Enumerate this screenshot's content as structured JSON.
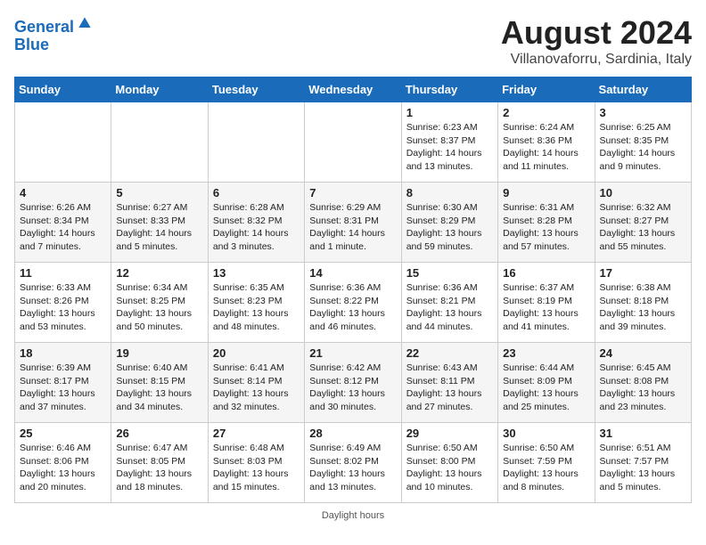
{
  "header": {
    "logo_line1": "General",
    "logo_line2": "Blue",
    "title": "August 2024",
    "subtitle": "Villanovaforru, Sardinia, Italy"
  },
  "days_of_week": [
    "Sunday",
    "Monday",
    "Tuesday",
    "Wednesday",
    "Thursday",
    "Friday",
    "Saturday"
  ],
  "weeks": [
    [
      {
        "day": "",
        "info": ""
      },
      {
        "day": "",
        "info": ""
      },
      {
        "day": "",
        "info": ""
      },
      {
        "day": "",
        "info": ""
      },
      {
        "day": "1",
        "info": "Sunrise: 6:23 AM\nSunset: 8:37 PM\nDaylight: 14 hours and 13 minutes."
      },
      {
        "day": "2",
        "info": "Sunrise: 6:24 AM\nSunset: 8:36 PM\nDaylight: 14 hours and 11 minutes."
      },
      {
        "day": "3",
        "info": "Sunrise: 6:25 AM\nSunset: 8:35 PM\nDaylight: 14 hours and 9 minutes."
      }
    ],
    [
      {
        "day": "4",
        "info": "Sunrise: 6:26 AM\nSunset: 8:34 PM\nDaylight: 14 hours and 7 minutes."
      },
      {
        "day": "5",
        "info": "Sunrise: 6:27 AM\nSunset: 8:33 PM\nDaylight: 14 hours and 5 minutes."
      },
      {
        "day": "6",
        "info": "Sunrise: 6:28 AM\nSunset: 8:32 PM\nDaylight: 14 hours and 3 minutes."
      },
      {
        "day": "7",
        "info": "Sunrise: 6:29 AM\nSunset: 8:31 PM\nDaylight: 14 hours and 1 minute."
      },
      {
        "day": "8",
        "info": "Sunrise: 6:30 AM\nSunset: 8:29 PM\nDaylight: 13 hours and 59 minutes."
      },
      {
        "day": "9",
        "info": "Sunrise: 6:31 AM\nSunset: 8:28 PM\nDaylight: 13 hours and 57 minutes."
      },
      {
        "day": "10",
        "info": "Sunrise: 6:32 AM\nSunset: 8:27 PM\nDaylight: 13 hours and 55 minutes."
      }
    ],
    [
      {
        "day": "11",
        "info": "Sunrise: 6:33 AM\nSunset: 8:26 PM\nDaylight: 13 hours and 53 minutes."
      },
      {
        "day": "12",
        "info": "Sunrise: 6:34 AM\nSunset: 8:25 PM\nDaylight: 13 hours and 50 minutes."
      },
      {
        "day": "13",
        "info": "Sunrise: 6:35 AM\nSunset: 8:23 PM\nDaylight: 13 hours and 48 minutes."
      },
      {
        "day": "14",
        "info": "Sunrise: 6:36 AM\nSunset: 8:22 PM\nDaylight: 13 hours and 46 minutes."
      },
      {
        "day": "15",
        "info": "Sunrise: 6:36 AM\nSunset: 8:21 PM\nDaylight: 13 hours and 44 minutes."
      },
      {
        "day": "16",
        "info": "Sunrise: 6:37 AM\nSunset: 8:19 PM\nDaylight: 13 hours and 41 minutes."
      },
      {
        "day": "17",
        "info": "Sunrise: 6:38 AM\nSunset: 8:18 PM\nDaylight: 13 hours and 39 minutes."
      }
    ],
    [
      {
        "day": "18",
        "info": "Sunrise: 6:39 AM\nSunset: 8:17 PM\nDaylight: 13 hours and 37 minutes."
      },
      {
        "day": "19",
        "info": "Sunrise: 6:40 AM\nSunset: 8:15 PM\nDaylight: 13 hours and 34 minutes."
      },
      {
        "day": "20",
        "info": "Sunrise: 6:41 AM\nSunset: 8:14 PM\nDaylight: 13 hours and 32 minutes."
      },
      {
        "day": "21",
        "info": "Sunrise: 6:42 AM\nSunset: 8:12 PM\nDaylight: 13 hours and 30 minutes."
      },
      {
        "day": "22",
        "info": "Sunrise: 6:43 AM\nSunset: 8:11 PM\nDaylight: 13 hours and 27 minutes."
      },
      {
        "day": "23",
        "info": "Sunrise: 6:44 AM\nSunset: 8:09 PM\nDaylight: 13 hours and 25 minutes."
      },
      {
        "day": "24",
        "info": "Sunrise: 6:45 AM\nSunset: 8:08 PM\nDaylight: 13 hours and 23 minutes."
      }
    ],
    [
      {
        "day": "25",
        "info": "Sunrise: 6:46 AM\nSunset: 8:06 PM\nDaylight: 13 hours and 20 minutes."
      },
      {
        "day": "26",
        "info": "Sunrise: 6:47 AM\nSunset: 8:05 PM\nDaylight: 13 hours and 18 minutes."
      },
      {
        "day": "27",
        "info": "Sunrise: 6:48 AM\nSunset: 8:03 PM\nDaylight: 13 hours and 15 minutes."
      },
      {
        "day": "28",
        "info": "Sunrise: 6:49 AM\nSunset: 8:02 PM\nDaylight: 13 hours and 13 minutes."
      },
      {
        "day": "29",
        "info": "Sunrise: 6:50 AM\nSunset: 8:00 PM\nDaylight: 13 hours and 10 minutes."
      },
      {
        "day": "30",
        "info": "Sunrise: 6:50 AM\nSunset: 7:59 PM\nDaylight: 13 hours and 8 minutes."
      },
      {
        "day": "31",
        "info": "Sunrise: 6:51 AM\nSunset: 7:57 PM\nDaylight: 13 hours and 5 minutes."
      }
    ]
  ],
  "footer": {
    "daylight_label": "Daylight hours"
  }
}
